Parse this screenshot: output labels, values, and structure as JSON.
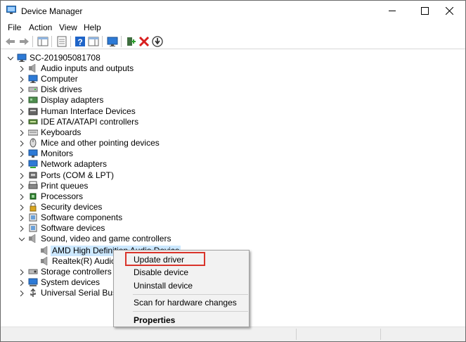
{
  "window": {
    "title": "Device Manager"
  },
  "menu": [
    "File",
    "Action",
    "View",
    "Help"
  ],
  "toolbar_icons": [
    "back-arrow-icon",
    "forward-arrow-icon",
    "show-hide-tree-icon",
    "properties-icon",
    "help-icon",
    "action-pane-icon",
    "scan-monitor-icon",
    "add-driver-icon",
    "uninstall-red-x-icon",
    "download-update-icon"
  ],
  "tree": {
    "root": "SC-201905081708",
    "categories": [
      "Audio inputs and outputs",
      "Computer",
      "Disk drives",
      "Display adapters",
      "Human Interface Devices",
      "IDE ATA/ATAPI controllers",
      "Keyboards",
      "Mice and other pointing devices",
      "Monitors",
      "Network adapters",
      "Ports (COM & LPT)",
      "Print queues",
      "Processors",
      "Security devices",
      "Software components",
      "Software devices",
      "Sound, video and game controllers"
    ],
    "sound_children": [
      "AMD High Definition Audio Device",
      "Realtek(R) Audio"
    ],
    "after": [
      "Storage controllers",
      "System devices",
      "Universal Serial Bus con"
    ]
  },
  "context_menu": {
    "items": [
      "Update driver",
      "Disable device",
      "Uninstall device",
      "Scan for hardware changes",
      "Properties"
    ]
  },
  "colors": {
    "selection": "#cce8ff",
    "highlight_box": "#d9342b"
  }
}
